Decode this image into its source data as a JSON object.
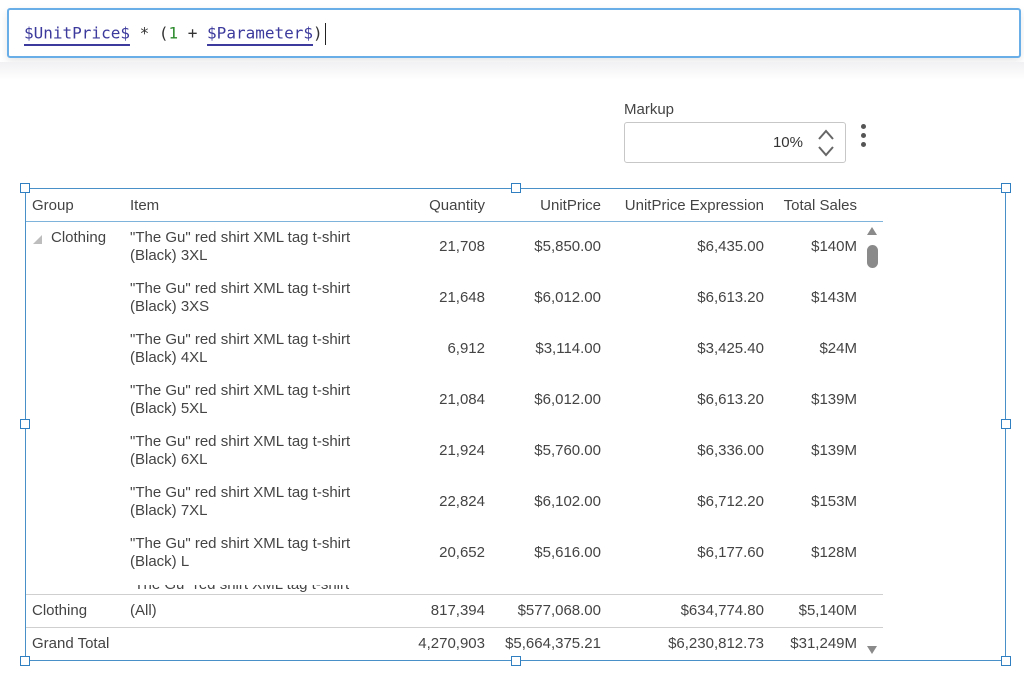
{
  "formula": {
    "field1": "$UnitPrice$",
    "op1": " * (",
    "num1": "1",
    "op2": " + ",
    "field2": "$Parameter$",
    "close": ")"
  },
  "markup": {
    "label": "Markup",
    "value": "10%"
  },
  "table": {
    "headers": [
      "Group",
      "Item",
      "Quantity",
      "UnitPrice",
      "UnitPrice Expression",
      "Total Sales"
    ],
    "group_name": "Clothing",
    "rows": [
      {
        "item": "\"The Gu\" red shirt XML tag t-shirt (Black) 3XL",
        "quantity": "21,708",
        "unit_price": "$5,850.00",
        "expr": "$6,435.00",
        "total": "$140M"
      },
      {
        "item": "\"The Gu\" red shirt XML tag t-shirt (Black) 3XS",
        "quantity": "21,648",
        "unit_price": "$6,012.00",
        "expr": "$6,613.20",
        "total": "$143M"
      },
      {
        "item": "\"The Gu\" red shirt XML tag t-shirt (Black) 4XL",
        "quantity": "6,912",
        "unit_price": "$3,114.00",
        "expr": "$3,425.40",
        "total": "$24M"
      },
      {
        "item": "\"The Gu\" red shirt XML tag t-shirt (Black) 5XL",
        "quantity": "21,084",
        "unit_price": "$6,012.00",
        "expr": "$6,613.20",
        "total": "$139M"
      },
      {
        "item": "\"The Gu\" red shirt XML tag t-shirt (Black) 6XL",
        "quantity": "21,924",
        "unit_price": "$5,760.00",
        "expr": "$6,336.00",
        "total": "$139M"
      },
      {
        "item": "\"The Gu\" red shirt XML tag t-shirt (Black) 7XL",
        "quantity": "22,824",
        "unit_price": "$6,102.00",
        "expr": "$6,712.20",
        "total": "$153M"
      },
      {
        "item": "\"The Gu\" red shirt XML tag t-shirt (Black) L",
        "quantity": "20,652",
        "unit_price": "$5,616.00",
        "expr": "$6,177.60",
        "total": "$128M"
      }
    ],
    "partial_row": "\"The Gu\" red shirt XML tag t-shirt",
    "subtotal": {
      "group": "Clothing",
      "item": "(All)",
      "quantity": "817,394",
      "unit_price": "$577,068.00",
      "expr": "$634,774.80",
      "total": "$5,140M"
    },
    "grand_total": {
      "label": "Grand Total",
      "quantity": "4,270,903",
      "unit_price": "$5,664,375.21",
      "expr": "$6,230,812.73",
      "total": "$31,249M"
    }
  },
  "colors": {
    "accent": "#4a90c8",
    "field_token": "#3c3a9c",
    "number_token": "#2b8a2b"
  }
}
